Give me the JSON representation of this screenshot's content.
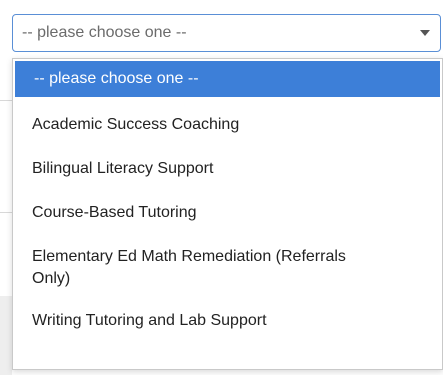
{
  "select": {
    "current_value": "-- please choose one --",
    "arrow_icon": "caret-down-icon"
  },
  "dropdown": {
    "options": [
      {
        "label": "-- please choose one --",
        "highlighted": true
      },
      {
        "label": "Academic Success Coaching"
      },
      {
        "label": "Bilingual Literacy Support"
      },
      {
        "label": "Course-Based Tutoring"
      },
      {
        "label": "Elementary Ed Math Remediation (Referrals Only)"
      },
      {
        "label": "Writing Tutoring and Lab Support"
      }
    ]
  },
  "colors": {
    "highlight": "#3d7fd8",
    "select_border": "#5a8fd6"
  }
}
